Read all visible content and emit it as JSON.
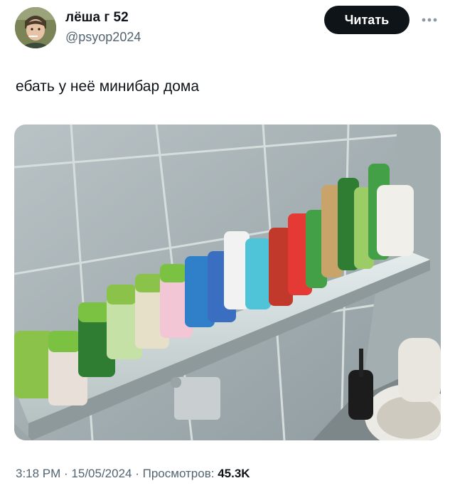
{
  "author": {
    "name": "лёша г 52",
    "handle": "@psyop2024"
  },
  "actions": {
    "follow_label": "Читать",
    "more_icon": "more-horizontal-icon"
  },
  "tweet": {
    "text": "ебать у неё минибар дома"
  },
  "meta": {
    "time": "3:18 PM",
    "separator": " · ",
    "date": "15/05/2024",
    "views_label": "Просмотров: ",
    "views_count": "45.3K"
  },
  "colors": {
    "text": "#0f1419",
    "secondary": "#536471",
    "button": "#0f1419"
  }
}
